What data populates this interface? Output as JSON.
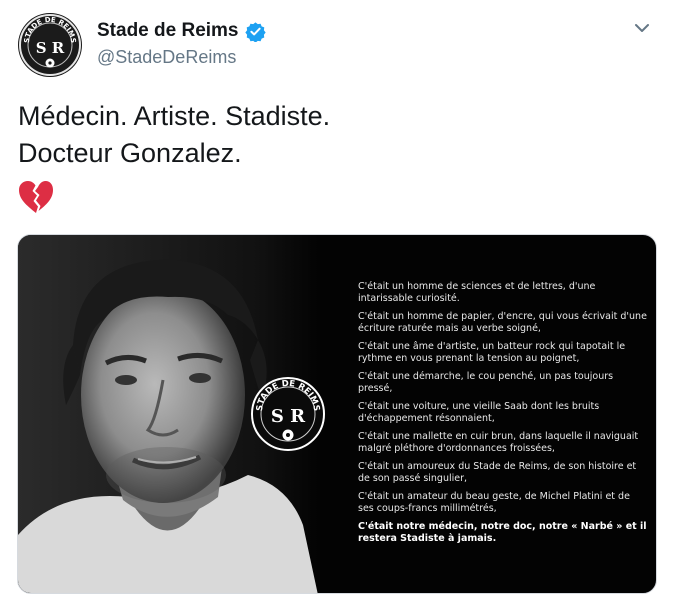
{
  "account": {
    "display_name": "Stade de Reims",
    "handle": "@StadeDeReims",
    "verified": true,
    "avatar_logo_text": "STADE DE REIMS",
    "avatar_monogram": "S R"
  },
  "icons": {
    "verified": "verified-badge-icon",
    "more": "chevron-down-icon",
    "emoji": "broken-heart-icon"
  },
  "tweet": {
    "lines": [
      "Médecin. Artiste. Stadiste.",
      "Docteur Gonzalez."
    ]
  },
  "media": {
    "logo_text": "STADE DE REIMS",
    "logo_monogram": "S R",
    "poem": [
      "C'était un homme de sciences et de lettres, d'une intarissable curiosité.",
      "C'était un homme de papier, d'encre, qui vous écrivait d'une écriture raturée mais au verbe soigné,",
      "C'était une âme d'artiste, un batteur rock qui tapotait le rythme en vous prenant la tension au poignet,",
      "C'était une démarche, le cou penché, un pas toujours pressé,",
      "C'était une voiture, une vieille Saab dont les bruits d'échappement résonnaient,",
      "C'était une mallette en cuir brun, dans laquelle il naviguait malgré pléthore d'ordonnances froissées,",
      "C'était un amoureux du Stade de Reims, de son histoire et de son passé singulier,",
      "C'était un amateur du beau geste, de Michel Platini et de ses coups-francs millimétrés,"
    ],
    "closing": "C'était notre médecin, notre doc, notre « Narbé » et il restera Stadiste à jamais."
  },
  "colors": {
    "verified_blue": "#1da1f2",
    "handle_gray": "#657786",
    "heart_red": "#dd2e44",
    "media_bg": "#030303"
  }
}
